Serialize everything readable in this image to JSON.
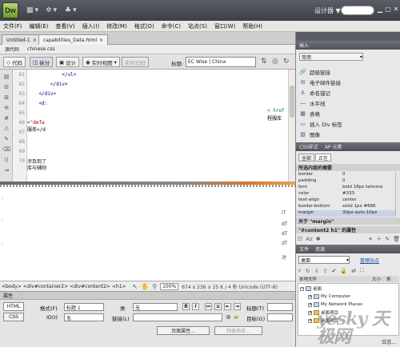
{
  "app": {
    "logo_text": "Dw",
    "workspace": "设计器 ▼"
  },
  "menu": [
    "文件(F)",
    "编辑(E)",
    "查看(V)",
    "插入(I)",
    "修改(M)",
    "格式(O)",
    "命令(C)",
    "站点(S)",
    "窗口(W)",
    "帮助(H)"
  ],
  "doc_tabs": [
    {
      "label": "Untitled-1",
      "close": "×"
    },
    {
      "label": "capabilities_Data.html",
      "close": "×"
    }
  ],
  "related_files": [
    "源代码",
    "chinese.css"
  ],
  "view_toolbar": {
    "code": "代码",
    "split": "拆分",
    "design": "设计",
    "live_view": "实时视图",
    "live_code": "实时代码",
    "title_label": "标题:",
    "title_value": "EC Wise | China"
  },
  "line_numbers": [
    "61",
    "62",
    "63",
    "64",
    "65",
    "66",
    "67",
    "68",
    "69",
    "70"
  ],
  "code_lines": [
    "            </ul>",
    "        </div>",
    "    </div>",
    "    <d:",
    "",
    "",
    "=\"defa",
    "服务</d",
    "",
    "",
    "涉及到了",
    "库与辅则"
  ],
  "code_right": [
    "< href",
    "程服库"
  ],
  "design_lines": [
    "iT",
    "",
    "dT",
    "",
    "dT",
    "dT",
    "",
    "对"
  ],
  "status": {
    "tags": "<body> <div#container2> <div#content2> <h1>",
    "zoom": "100%",
    "size": "674 x 236 ∨  25 K / 4 秒  Unicode (UTF-8)"
  },
  "props": {
    "title": "属性",
    "html_btn": "HTML",
    "css_btn": "CSS",
    "format_label": "格式(F)",
    "format_value": "标题 1",
    "id_label": "ID(I)",
    "id_value": "无",
    "class_label": "类",
    "class_value": "无",
    "link_label": "链接(L)",
    "title_label": "标题(T)",
    "target_label": "目标(G)",
    "page_props": "页面属性...",
    "list_item": "列表项目..."
  },
  "insert_panel": {
    "title": "插入",
    "category": "常用",
    "items": [
      "超级链接",
      "电子邮件链接",
      "命名锚记",
      "水平线",
      "表格",
      "插入 Div 标签",
      "图像"
    ]
  },
  "css_panel": {
    "tabs": [
      "CSS样式",
      "AP 元素"
    ],
    "mode_all": "全部",
    "mode_current": "正在",
    "summary_title": "所选内容的摘要",
    "rows": [
      {
        "k": "border",
        "v": "0"
      },
      {
        "k": "padding",
        "v": "0"
      },
      {
        "k": "font",
        "v": "bold 18px tahoma"
      },
      {
        "k": "color",
        "v": "#333"
      },
      {
        "k": "text-align",
        "v": "center"
      },
      {
        "k": "border-bottom",
        "v": "solid 1px #666"
      },
      {
        "k": "margin",
        "v": "30px auto 10px"
      }
    ],
    "about_title": "关于 \"margin\"",
    "rule_title": "\"#content2 h1\" 的属性"
  },
  "files_panel": {
    "tabs": [
      "文件",
      "资源"
    ],
    "site": "桌面",
    "manage": "管理站点",
    "col_local": "本地文件",
    "col_size": "大小",
    "col_type": "类",
    "tree": [
      {
        "label": "桌面",
        "level": 0
      },
      {
        "label": "My Computer",
        "level": 1
      },
      {
        "label": "My Network Places",
        "level": 1
      },
      {
        "label": "桌面项目",
        "level": 1
      },
      {
        "label": "桌面项目",
        "level": 1
      }
    ],
    "date_label": "日志..."
  },
  "watermark": "yesky 天极网"
}
